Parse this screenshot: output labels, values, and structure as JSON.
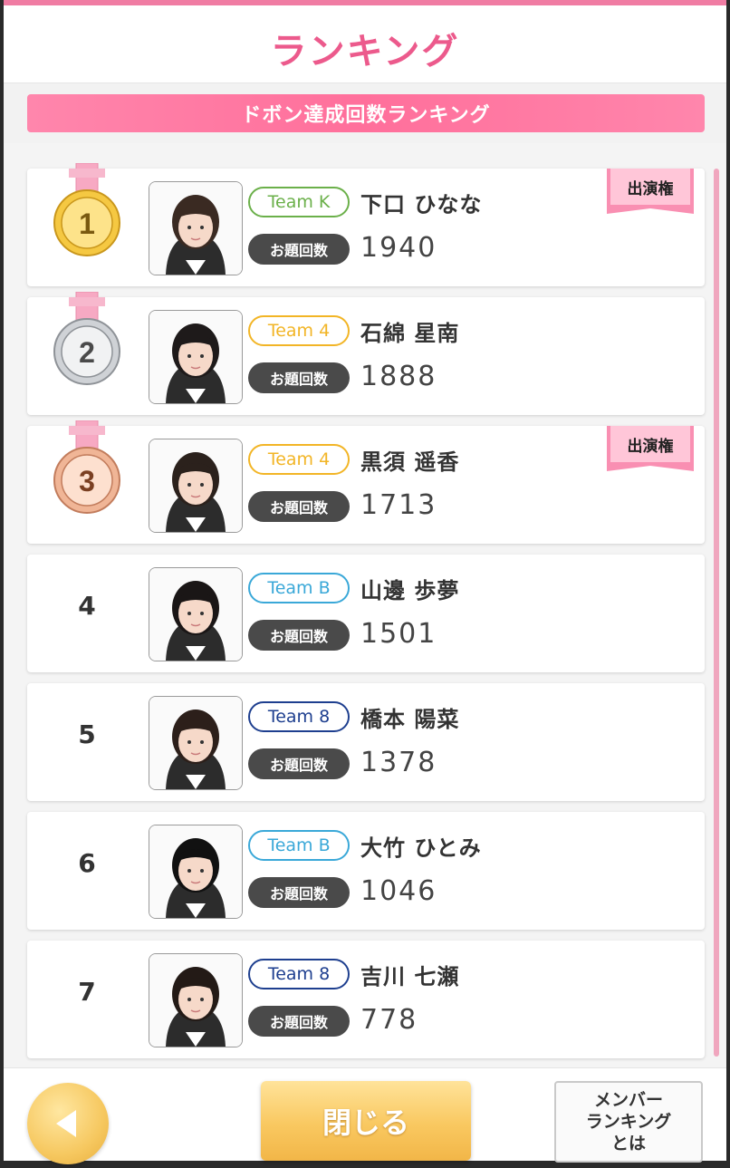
{
  "header": {
    "title": "ランキング"
  },
  "banner": {
    "label": "ドボン達成回数ランキング"
  },
  "count_label": "お題回数",
  "rankings": [
    {
      "rank": "1",
      "team": "Team K",
      "team_color": "#6bb04a",
      "name": "下口 ひなな",
      "count": "1940",
      "badge": "出演権"
    },
    {
      "rank": "2",
      "team": "Team 4",
      "team_color": "#f2b526",
      "name": "石綿 星南",
      "count": "1888",
      "badge": ""
    },
    {
      "rank": "3",
      "team": "Team 4",
      "team_color": "#f2b526",
      "name": "黒須 遥香",
      "count": "1713",
      "badge": "出演権"
    },
    {
      "rank": "4",
      "team": "Team B",
      "team_color": "#3aa8d8",
      "name": "山邊 歩夢",
      "count": "1501",
      "badge": ""
    },
    {
      "rank": "5",
      "team": "Team 8",
      "team_color": "#1e3f8f",
      "name": "橋本 陽菜",
      "count": "1378",
      "badge": ""
    },
    {
      "rank": "6",
      "team": "Team B",
      "team_color": "#3aa8d8",
      "name": "大竹 ひとみ",
      "count": "1046",
      "badge": ""
    },
    {
      "rank": "7",
      "team": "Team 8",
      "team_color": "#1e3f8f",
      "name": "吉川 七瀬",
      "count": "778",
      "badge": ""
    }
  ],
  "footer": {
    "back_icon": "triangle-left",
    "close_label": "閉じる",
    "info_label": "メンバー\nランキング\nとは"
  }
}
